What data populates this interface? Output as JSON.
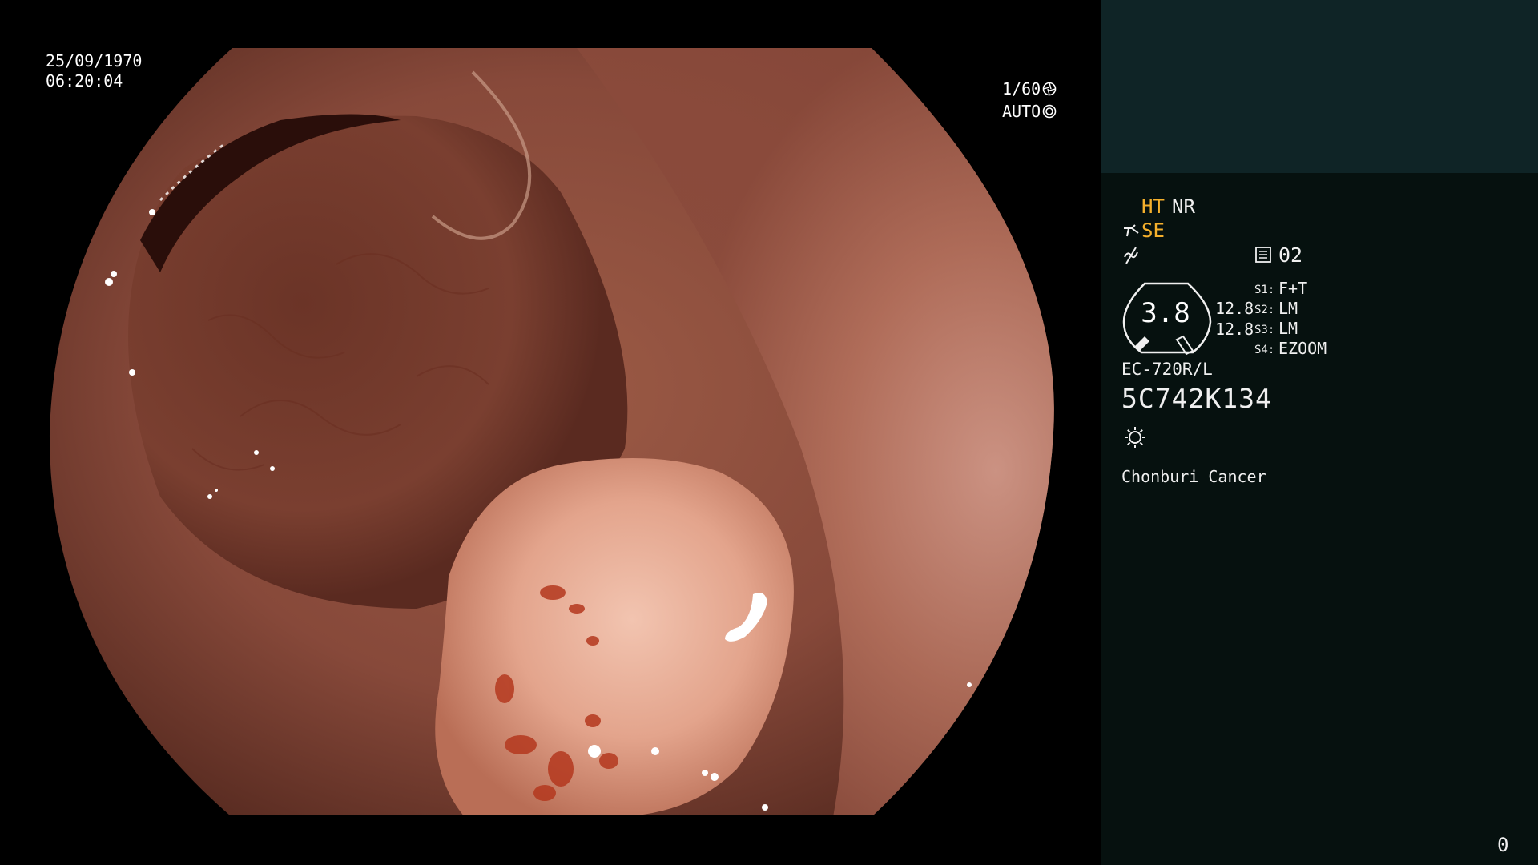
{
  "overlay": {
    "date": "25/09/1970",
    "time": "06:20:04",
    "shutter": "1/60",
    "iris_mode": "AUTO"
  },
  "panel": {
    "ht_label": "HT",
    "nr_label": "NR",
    "se_label": "SE",
    "channel": "02",
    "gauge_value": "3.8",
    "value_a": "12.8",
    "value_b": "12.8",
    "switches": [
      {
        "key": "S1:",
        "value": "F+T"
      },
      {
        "key": "S2:",
        "value": "LM"
      },
      {
        "key": "S3:",
        "value": "LM"
      },
      {
        "key": "S4:",
        "value": "EZOOM"
      }
    ],
    "scope_model": "EC-720R/L",
    "serial_number": "5C742K134",
    "institution": "Chonburi Cancer",
    "page_counter": "0"
  },
  "icons": {
    "shutter": "aperture-icon",
    "iris": "iris-icon",
    "structure_enhance": "scope-tip-icon",
    "modulation": "modulation-icon",
    "record": "document-icon",
    "light": "light-source-icon"
  },
  "colors": {
    "panel_bg": "#06110f",
    "panel_top_bg": "#0f2426",
    "accent": "#f5b02c",
    "text": "#f0f0f0"
  }
}
